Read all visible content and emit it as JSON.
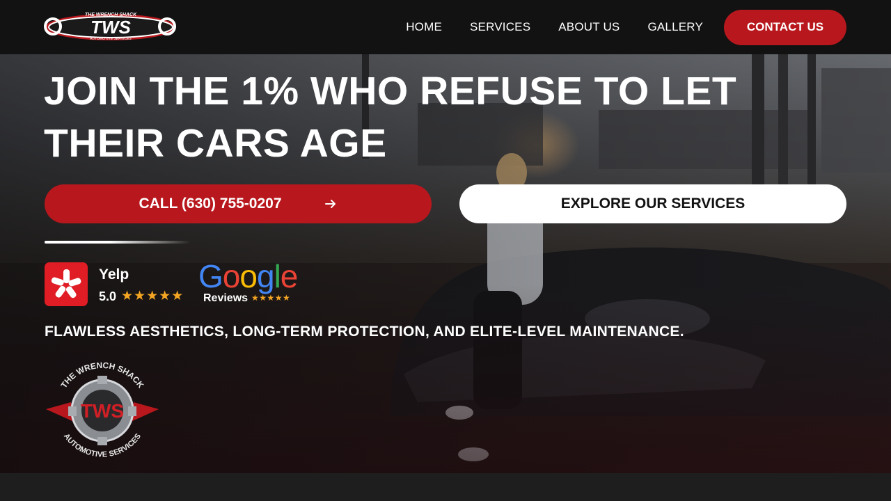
{
  "header": {
    "logo_text": "TWS",
    "logo_subtext_top": "THE WRENCH SHACK",
    "logo_subtext_bottom": "AUTOMOTIVE SERVICES",
    "nav": [
      {
        "label": "HOME"
      },
      {
        "label": "SERVICES"
      },
      {
        "label": "ABOUT US"
      },
      {
        "label": "GALLERY"
      }
    ],
    "contact_label": "CONTACT US"
  },
  "hero": {
    "headline_line1": "JOIN THE 1% WHO REFUSE TO LET",
    "headline_line2": "THEIR CARS AGE",
    "call_label": "CALL (630) 755-0207",
    "explore_label": "EXPLORE OUR SERVICES",
    "yelp": {
      "name": "Yelp",
      "rating": "5.0",
      "stars": "★★★★★"
    },
    "google": {
      "wordmark": "Google",
      "reviews_label": "Reviews",
      "stars": "★★★★★"
    },
    "tagline": "FLAWLESS AESTHETICS, LONG-TERM PROTECTION, AND ELITE-LEVEL MAINTENANCE.",
    "emblem": {
      "arc_top": "THE WRENCH SHACK",
      "center": "TWS",
      "arc_bottom": "AUTOMOTIVE SERVICES"
    }
  },
  "icons": {
    "call_arrow": "arrow-right-icon",
    "yelp": "yelp-burst-icon",
    "stars": "star-icon"
  },
  "colors": {
    "brand_red": "#b8181d",
    "header_bg": "#121212",
    "star": "#f4a623",
    "yelp_red": "#e01c24"
  }
}
